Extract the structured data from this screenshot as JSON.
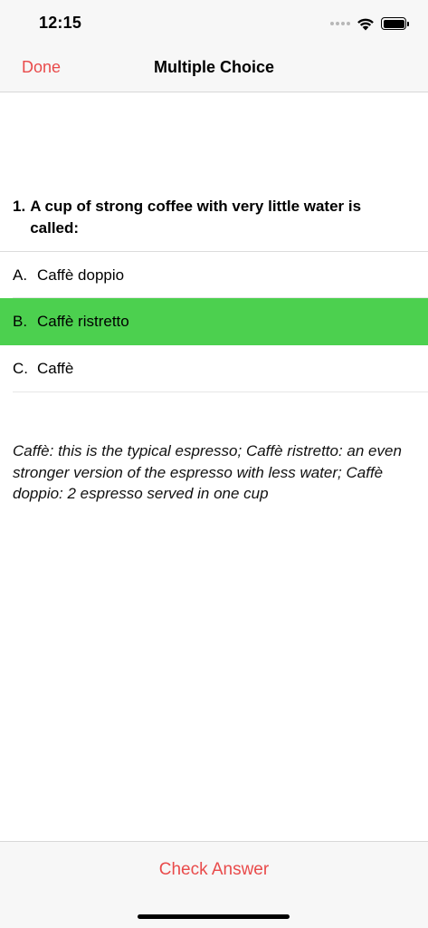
{
  "status_bar": {
    "time": "12:15",
    "icons": [
      "cellular-dots-icon",
      "wifi-icon",
      "battery-icon"
    ],
    "battery_level": 1.0
  },
  "nav": {
    "done_label": "Done",
    "title": "Multiple Choice"
  },
  "question": {
    "number": "1.",
    "text": "A cup of strong coffee with very little water is called:"
  },
  "options": [
    {
      "letter": "A.",
      "text": "Caffè doppio",
      "selected": false
    },
    {
      "letter": "B.",
      "text": "Caffè ristretto",
      "selected": true
    },
    {
      "letter": "C.",
      "text": "Caffè",
      "selected": false
    }
  ],
  "explanation": "Caffè: this is the typical espresso; Caffè ristretto: an even stronger version of the espresso with less water; Caffè doppio: 2 espresso served in one cup",
  "bottom": {
    "check_label": "Check Answer"
  },
  "colors": {
    "accent": "#e94b4b",
    "selected_option": "#4cd04f",
    "bar_background": "#f7f7f7"
  }
}
